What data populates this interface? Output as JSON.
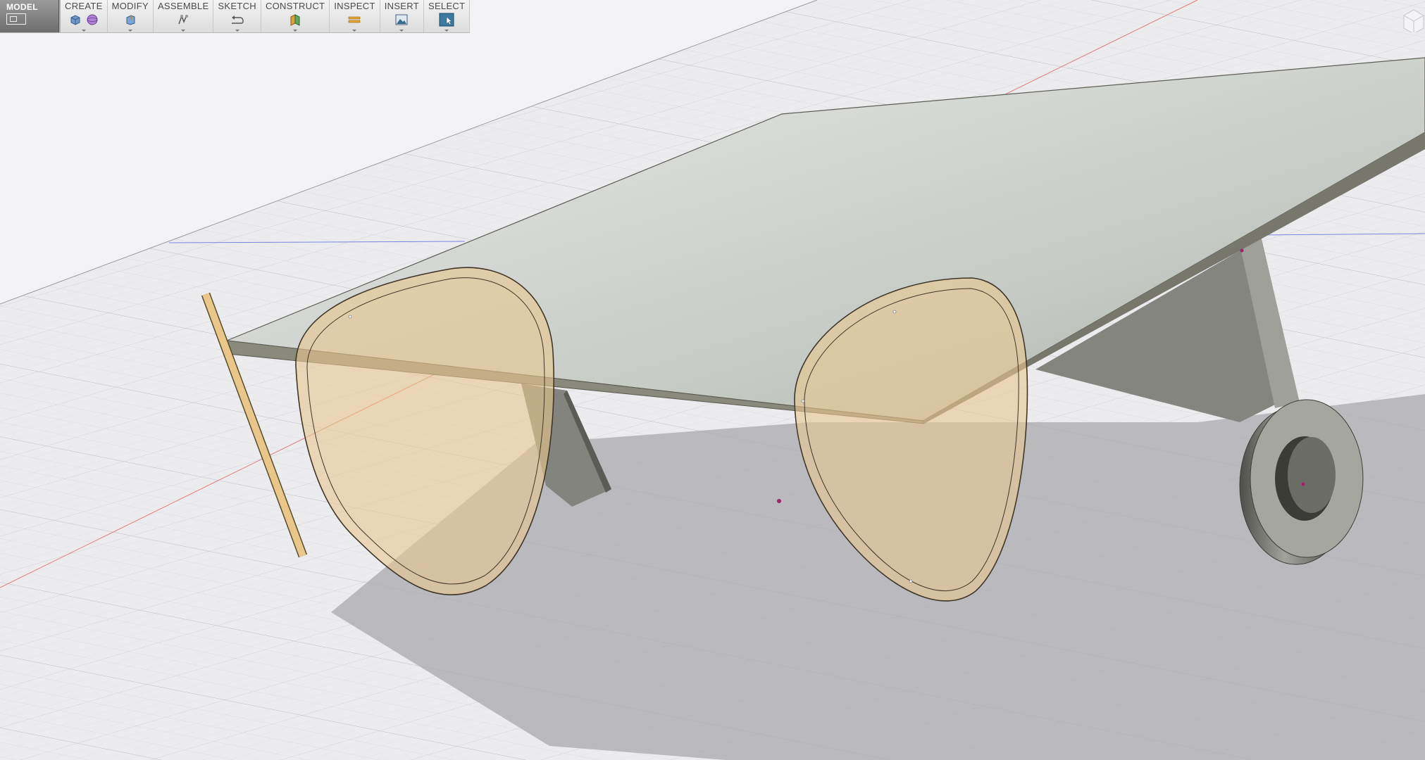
{
  "toolbar": {
    "workspace": {
      "label": "MODEL",
      "icon": "model-workspace-icon"
    },
    "menus": [
      {
        "label": "CREATE",
        "icons": [
          "box-icon",
          "sphere-icon"
        ]
      },
      {
        "label": "MODIFY",
        "icons": [
          "press-pull-icon"
        ]
      },
      {
        "label": "ASSEMBLE",
        "icons": [
          "joint-icon"
        ]
      },
      {
        "label": "SKETCH",
        "icons": [
          "sketch-curve-icon"
        ]
      },
      {
        "label": "CONSTRUCT",
        "icons": [
          "offset-plane-icon"
        ]
      },
      {
        "label": "INSPECT",
        "icons": [
          "measure-icon"
        ]
      },
      {
        "label": "INSERT",
        "icons": [
          "insert-image-icon"
        ]
      },
      {
        "label": "SELECT",
        "icons": [
          "select-arrow-icon"
        ]
      }
    ]
  },
  "colors": {
    "background": "#f2f2f4",
    "grid": "#cfcfd6",
    "plate_top": "#d8dcd8",
    "plate_edge": "#6a6a5e",
    "sketch_fill": "#e8c88c",
    "sketch_stroke": "#4a4030",
    "solid_gray": "#7d7d78",
    "shadow": "#a6a6aa",
    "axis_red": "#e06060",
    "axis_blue": "#6a78d8",
    "point_magenta": "#a0206a"
  }
}
